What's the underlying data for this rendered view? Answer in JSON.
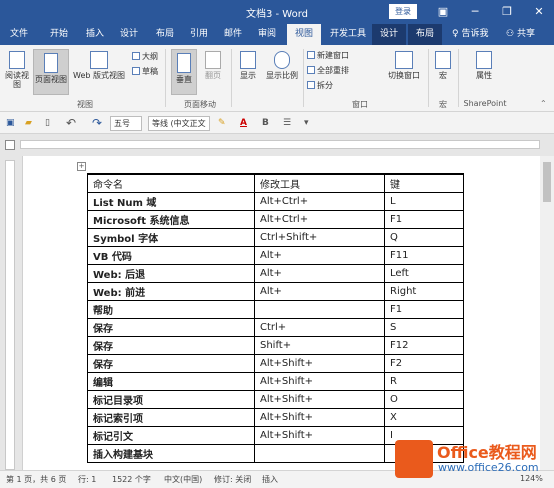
{
  "window": {
    "title": "文档3 - Word",
    "login": "登录",
    "minimize": "─",
    "restore": "❐",
    "close": "✕",
    "restore_ribbon": "▣"
  },
  "tabs": [
    {
      "label": "文件"
    },
    {
      "label": "开始"
    },
    {
      "label": "插入"
    },
    {
      "label": "设计"
    },
    {
      "label": "布局"
    },
    {
      "label": "引用"
    },
    {
      "label": "邮件"
    },
    {
      "label": "审阅"
    },
    {
      "label": "视图"
    },
    {
      "label": "开发工具"
    },
    {
      "label": "设计"
    },
    {
      "label": "布局"
    }
  ],
  "tell_me": "告诉我",
  "share": "共享",
  "ribbon": {
    "read_mode": "阅读视图",
    "print_layout": "页面视图",
    "web_layout": "Web 版式视图",
    "outline": "大纲",
    "draft": "草稿",
    "views_group": "视图",
    "vertical": "垂直",
    "side_by_side": "翻页",
    "page_move_group": "页面移动",
    "show": "显示",
    "zoom": "显示比例",
    "new_window": "新建窗口",
    "arrange_all": "全部重排",
    "split": "拆分",
    "switch_windows": "切换窗口",
    "window_group": "窗口",
    "macros": "宏",
    "macros_group": "宏",
    "properties": "属性",
    "sharepoint_group": "SharePoint"
  },
  "qat": {
    "font_size": "五号",
    "font_name": "等线 (中文正文",
    "font_color_letter": "A",
    "undo": "↶",
    "redo": "↷"
  },
  "table": {
    "headers": [
      "命令名",
      "修改工具",
      "键"
    ],
    "rows": [
      [
        "List Num  域",
        "Alt+Ctrl+",
        "L"
      ],
      [
        "Microsoft  系统信息",
        "Alt+Ctrl+",
        "F1"
      ],
      [
        "Symbol  字体",
        "Ctrl+Shift+",
        "Q"
      ],
      [
        "VB  代码",
        "Alt+",
        "F11"
      ],
      [
        "Web:  后退",
        "Alt+",
        "Left"
      ],
      [
        "Web:  前进",
        "Alt+",
        "Right"
      ],
      [
        "帮助",
        "",
        "F1"
      ],
      [
        "保存",
        "Ctrl+",
        "S"
      ],
      [
        "保存",
        "Shift+",
        "F12"
      ],
      [
        "保存",
        "Alt+Shift+",
        "F2"
      ],
      [
        "编辑",
        "Alt+Shift+",
        "R"
      ],
      [
        "标记目录项",
        "Alt+Shift+",
        "O"
      ],
      [
        "标记索引项",
        "Alt+Shift+",
        "X"
      ],
      [
        "标记引文",
        "Alt+Shift+",
        "I"
      ],
      [
        "插入构建基块",
        "",
        ""
      ]
    ]
  },
  "status": {
    "page": "第 1 页，共 6 页",
    "line": "行: 1",
    "words": "1522 个字",
    "lang": "中文(中国)",
    "track": "修订: 关闭",
    "insert": "插入",
    "zoom": "124%"
  },
  "watermark": {
    "title": "Office教程网",
    "url": "www.office26.com"
  },
  "colors": {
    "titlebar": "#2b579a",
    "watermark": "#ea5a1c"
  }
}
